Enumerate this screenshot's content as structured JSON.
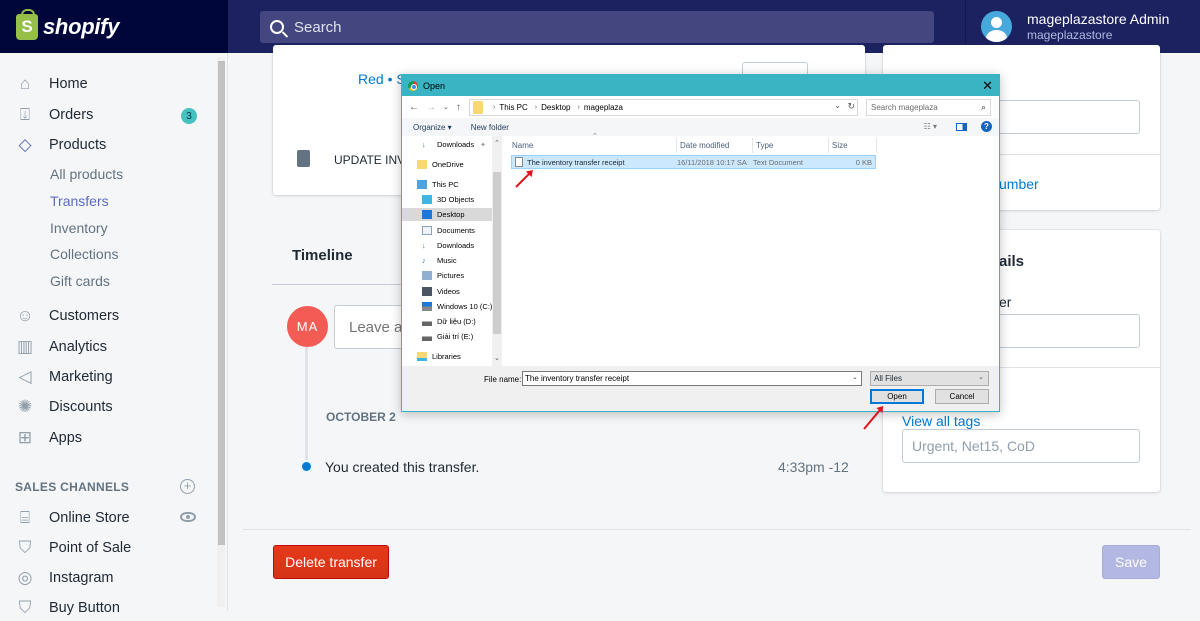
{
  "header": {
    "logo_text": "shopify",
    "search_placeholder": "Search",
    "user_name": "mageplazastore Admin",
    "user_store": "mageplazastore"
  },
  "sidebar": {
    "items": [
      {
        "label": "Home",
        "icon": "home-icon"
      },
      {
        "label": "Orders",
        "icon": "orders-icon",
        "badge": "3"
      },
      {
        "label": "Products",
        "icon": "tag-icon"
      },
      {
        "label": "Customers",
        "icon": "customers-icon"
      },
      {
        "label": "Analytics",
        "icon": "analytics-icon"
      },
      {
        "label": "Marketing",
        "icon": "megaphone-icon"
      },
      {
        "label": "Discounts",
        "icon": "discount-icon"
      },
      {
        "label": "Apps",
        "icon": "apps-icon"
      }
    ],
    "product_subitems": [
      "All products",
      "Transfers",
      "Inventory",
      "Collections",
      "Gift cards"
    ],
    "active_subitem": "Transfers",
    "sales_channels_header": "SALES CHANNELS",
    "channels": [
      {
        "label": "Online Store",
        "icon": "store-icon"
      },
      {
        "label": "Point of Sale",
        "icon": "pos-bag-icon"
      },
      {
        "label": "Instagram",
        "icon": "instagram-icon"
      },
      {
        "label": "Buy Button",
        "icon": "buy-button-icon"
      }
    ]
  },
  "main": {
    "variant_link": "Red • S",
    "update_inventory_label": "UPDATE INVE",
    "timeline": {
      "title": "Timeline",
      "avatar_initials": "MA",
      "comment_placeholder": "Leave a",
      "date_label": "OCTOBER 2",
      "event_text": "You created this transfer.",
      "event_time": "4:33pm -12"
    },
    "delete_button": "Delete transfer",
    "save_button": "Save"
  },
  "right_panel": {
    "tracking_link_partial": "umber",
    "details_title_partial": "ails",
    "details_label_partial": "er",
    "view_all_tags": "View all tags",
    "tags_placeholder": "Urgent, Net15, CoD"
  },
  "dialog": {
    "title": "Open",
    "breadcrumb": [
      "This PC",
      "Desktop",
      "mageplaza"
    ],
    "search_placeholder": "Search mageplaza",
    "organize_label": "Organize ▾",
    "new_folder_label": "New folder",
    "nav_pane": [
      {
        "label": "Downloads",
        "icon": "download-arrow-icon",
        "pinned": true
      },
      {
        "label": "OneDrive",
        "icon": "folder-icon"
      },
      {
        "label": "This PC",
        "icon": "computer-icon"
      },
      {
        "label": "3D Objects",
        "icon": "cube-icon"
      },
      {
        "label": "Desktop",
        "icon": "desktop-icon",
        "selected": true
      },
      {
        "label": "Documents",
        "icon": "documents-icon"
      },
      {
        "label": "Downloads",
        "icon": "download-arrow-icon"
      },
      {
        "label": "Music",
        "icon": "music-icon"
      },
      {
        "label": "Pictures",
        "icon": "pictures-icon"
      },
      {
        "label": "Videos",
        "icon": "videos-icon"
      },
      {
        "label": "Windows 10 (C:)",
        "icon": "drive-icon"
      },
      {
        "label": "Dữ liệu (D:)",
        "icon": "drive-icon"
      },
      {
        "label": "Giải trí (E:)",
        "icon": "drive-icon"
      },
      {
        "label": "Libraries",
        "icon": "libraries-icon"
      }
    ],
    "columns": [
      "Name",
      "Date modified",
      "Type",
      "Size"
    ],
    "files": [
      {
        "name": "The inventory transfer receipt",
        "date_modified": "16/11/2018 10:17 SA",
        "type": "Text Document",
        "size": "0 KB"
      }
    ],
    "file_name_label": "File name:",
    "file_name_value": "The inventory transfer receipt",
    "file_type": "All Files",
    "open_button": "Open",
    "cancel_button": "Cancel"
  },
  "colors": {
    "topbar": "#1c2260",
    "accent": "#5c6ac4",
    "danger": "#de3618",
    "dialog_title": "#3ab4c3",
    "annotation_arrow": "#e0141e"
  }
}
